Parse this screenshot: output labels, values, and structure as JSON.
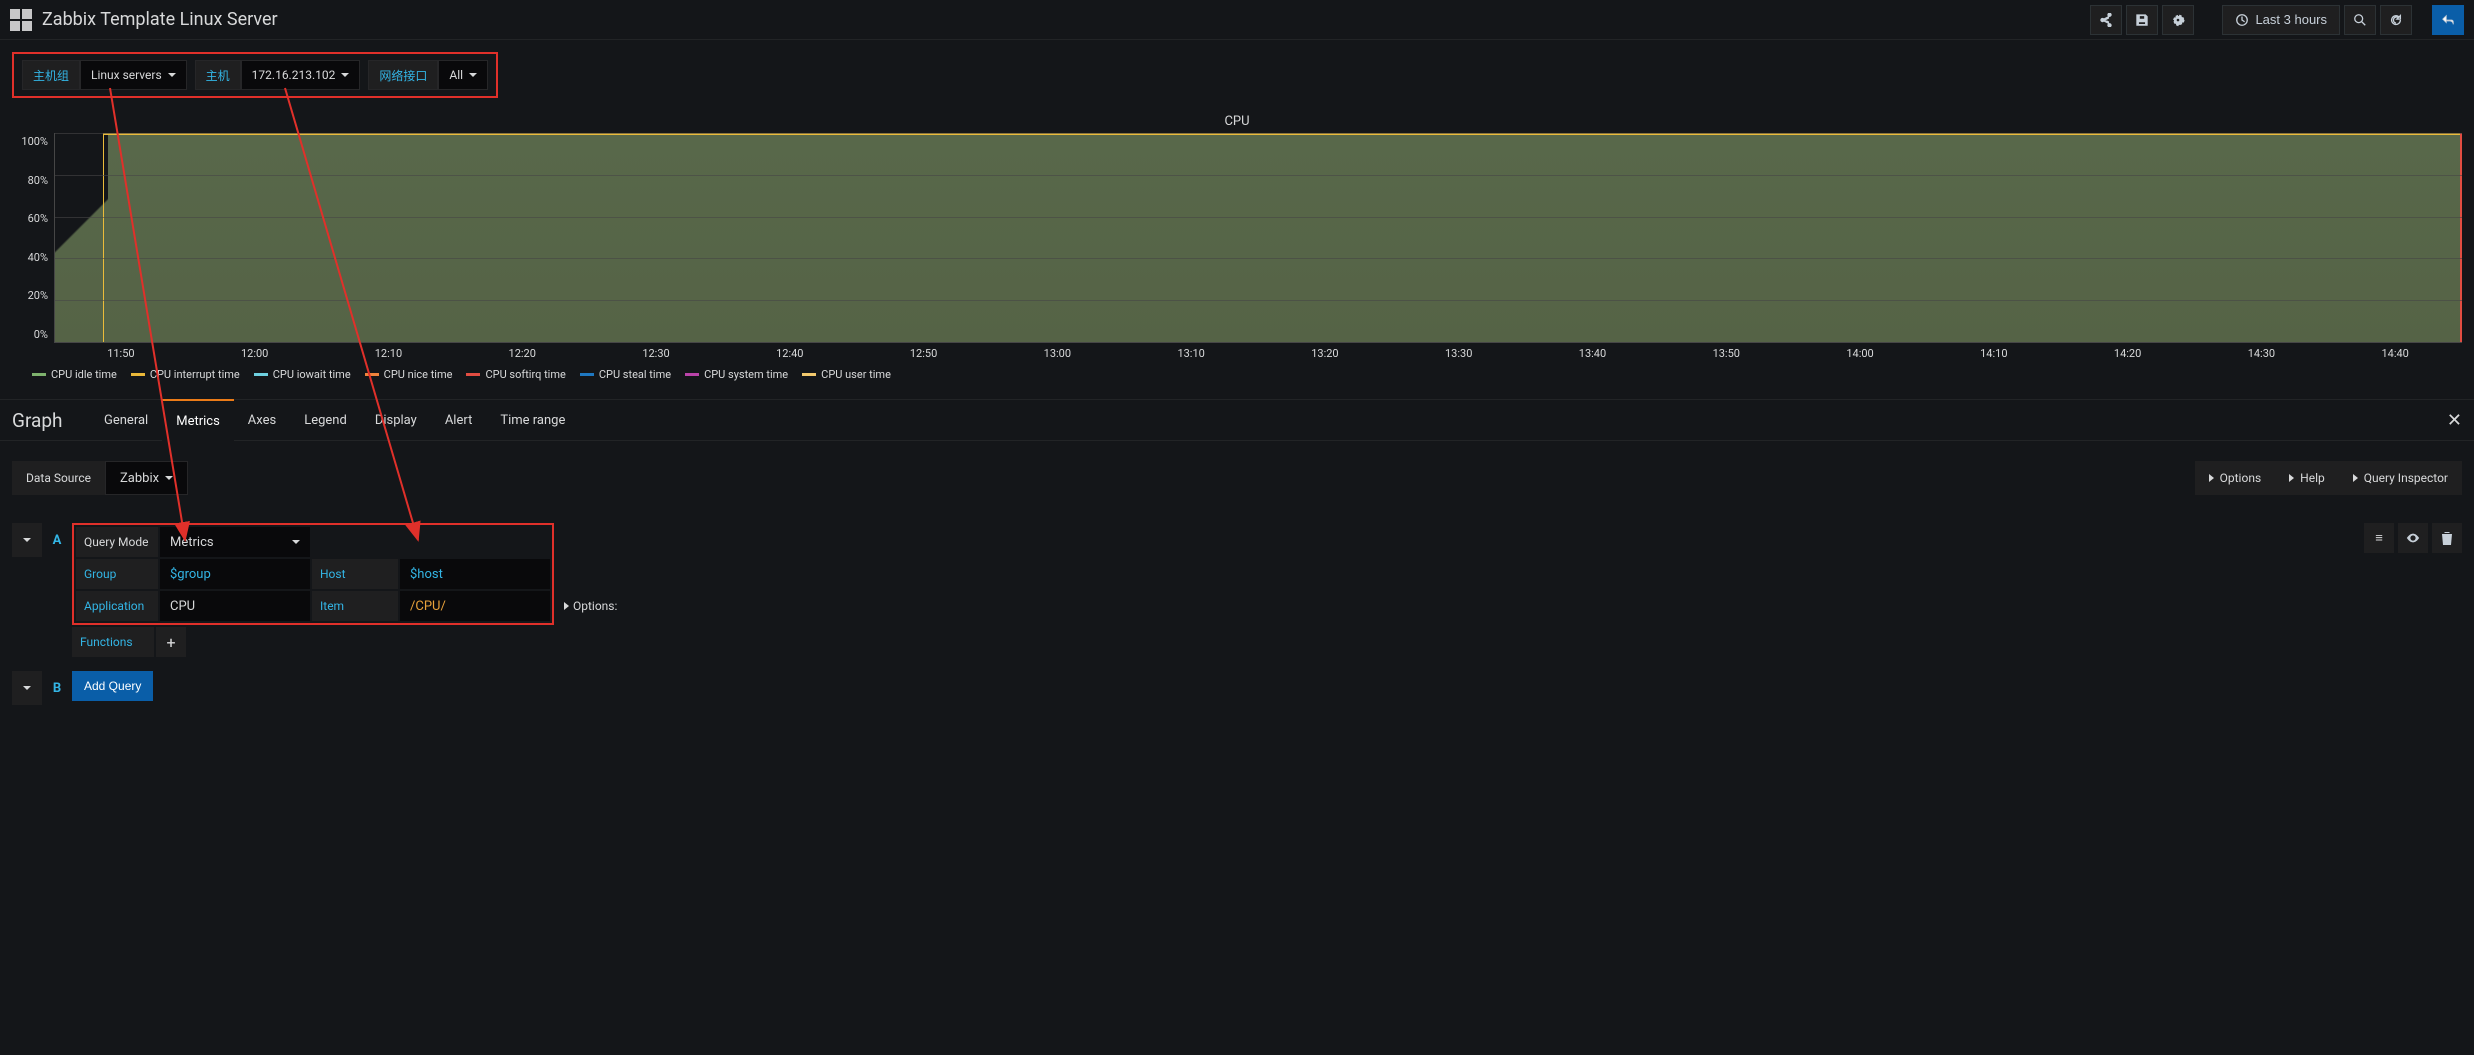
{
  "header": {
    "title": "Zabbix Template Linux Server",
    "time_range_label": "Last 3 hours"
  },
  "variables": [
    {
      "label": "主机组",
      "value": "Linux servers"
    },
    {
      "label": "主机",
      "value": "172.16.213.102"
    },
    {
      "label": "网络接口",
      "value": "All"
    }
  ],
  "chart_data": {
    "type": "area",
    "title": "CPU",
    "ylabel": "",
    "ylim": [
      0,
      100
    ],
    "y_ticks": [
      "100%",
      "80%",
      "60%",
      "40%",
      "20%",
      "0%"
    ],
    "x_ticks": [
      "11:50",
      "12:00",
      "12:10",
      "12:20",
      "12:30",
      "12:40",
      "12:50",
      "13:00",
      "13:10",
      "13:20",
      "13:30",
      "13:40",
      "13:50",
      "14:00",
      "14:10",
      "14:20",
      "14:30",
      "14:40"
    ],
    "series": [
      {
        "name": "CPU idle time",
        "color": "#7eb26d",
        "approx_value_pct": 99
      },
      {
        "name": "CPU interrupt time",
        "color": "#eab839",
        "approx_value_pct": 0
      },
      {
        "name": "CPU iowait time",
        "color": "#6ed0e0",
        "approx_value_pct": 0
      },
      {
        "name": "CPU nice time",
        "color": "#ef843c",
        "approx_value_pct": 0
      },
      {
        "name": "CPU softirq time",
        "color": "#e24d42",
        "approx_value_pct": 0
      },
      {
        "name": "CPU steal time",
        "color": "#1f78c1",
        "approx_value_pct": 0
      },
      {
        "name": "CPU system time",
        "color": "#ba43a9",
        "approx_value_pct": 0
      },
      {
        "name": "CPU user time",
        "color": "#f2c96d",
        "approx_value_pct": 1
      }
    ]
  },
  "editor": {
    "kind": "Graph",
    "tabs": [
      "General",
      "Metrics",
      "Axes",
      "Legend",
      "Display",
      "Alert",
      "Time range"
    ],
    "active_tab": "Metrics"
  },
  "datasource": {
    "label": "Data Source",
    "value": "Zabbix",
    "right_buttons": [
      "Options",
      "Help",
      "Query Inspector"
    ]
  },
  "queryA": {
    "letter": "A",
    "mode_label": "Query Mode",
    "mode_value": "Metrics",
    "group_label": "Group",
    "group_value": "$group",
    "host_label": "Host",
    "host_value": "$host",
    "app_label": "Application",
    "app_value": "CPU",
    "item_label": "Item",
    "item_value": "/CPU/",
    "options_label": "Options:",
    "functions_label": "Functions"
  },
  "queryB": {
    "letter": "B",
    "add_query_label": "Add Query"
  }
}
